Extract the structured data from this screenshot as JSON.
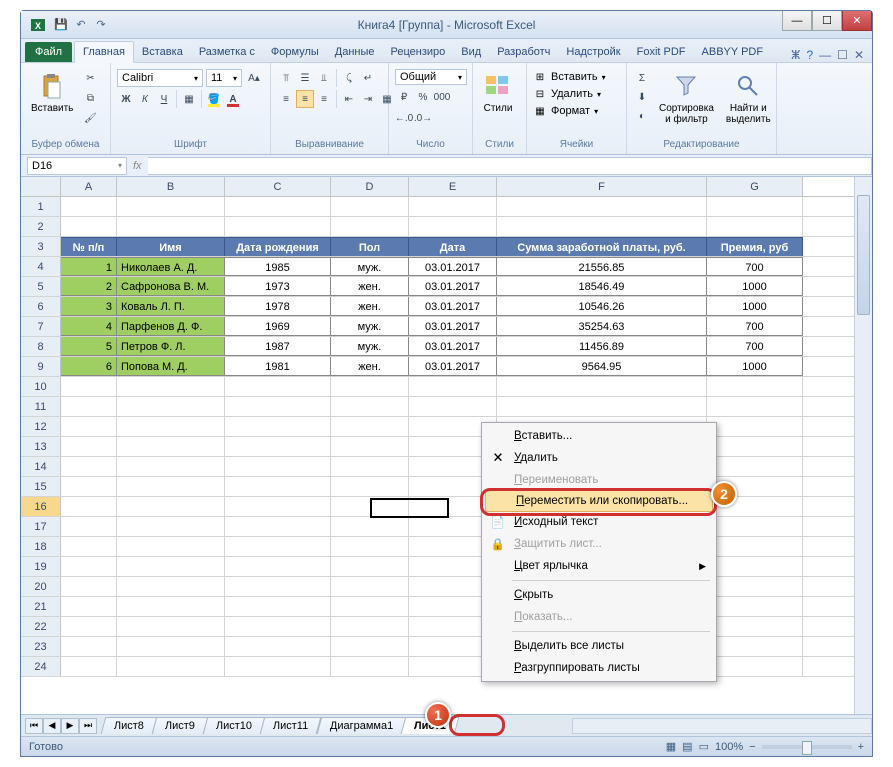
{
  "window": {
    "title": "Книга4  [Группа]  -  Microsoft Excel"
  },
  "ribbon_tabs": {
    "file": "Файл",
    "items": [
      "Главная",
      "Вставка",
      "Разметка с",
      "Формулы",
      "Данные",
      "Рецензиро",
      "Вид",
      "Разработч",
      "Надстройк",
      "Foxit PDF",
      "ABBYY PDF"
    ],
    "active_index": 0
  },
  "ribbon": {
    "clipboard": {
      "label": "Буфер обмена",
      "paste": "Вставить"
    },
    "font": {
      "label": "Шрифт",
      "name": "Calibri",
      "size": "11"
    },
    "alignment": {
      "label": "Выравнивание"
    },
    "number": {
      "label": "Число",
      "format": "Общий"
    },
    "styles": {
      "label": "Стили",
      "btn": "Стили"
    },
    "cells": {
      "label": "Ячейки",
      "insert": "Вставить",
      "delete": "Удалить",
      "format": "Формат"
    },
    "editing": {
      "label": "Редактирование",
      "sort": "Сортировка\nи фильтр",
      "find": "Найти и\nвыделить"
    }
  },
  "namebox": "D16",
  "fx_label": "fx",
  "columns": [
    "A",
    "B",
    "C",
    "D",
    "E",
    "F",
    "G"
  ],
  "table": {
    "headers": [
      "№ п/п",
      "Имя",
      "Дата рождения",
      "Пол",
      "Дата",
      "Сумма заработной платы, руб.",
      "Премия, руб"
    ],
    "rows": [
      [
        "1",
        "Николаев А. Д.",
        "1985",
        "муж.",
        "03.01.2017",
        "21556.85",
        "700"
      ],
      [
        "2",
        "Сафронова В. М.",
        "1973",
        "жен.",
        "03.01.2017",
        "18546.49",
        "1000"
      ],
      [
        "3",
        "Коваль Л. П.",
        "1978",
        "жен.",
        "03.01.2017",
        "10546.26",
        "1000"
      ],
      [
        "4",
        "Парфенов Д. Ф.",
        "1969",
        "муж.",
        "03.01.2017",
        "35254.63",
        "700"
      ],
      [
        "5",
        "Петров Ф. Л.",
        "1987",
        "муж.",
        "03.01.2017",
        "11456.89",
        "700"
      ],
      [
        "6",
        "Попова М. Д.",
        "1981",
        "жен.",
        "03.01.2017",
        "9564.95",
        "1000"
      ]
    ]
  },
  "context_menu": {
    "items": [
      {
        "label": "Вставить...",
        "icon": "",
        "enabled": true
      },
      {
        "label": "Удалить",
        "icon": "del",
        "enabled": true
      },
      {
        "label": "Переименовать",
        "icon": "",
        "enabled": false
      },
      {
        "label": "Переместить или скопировать...",
        "icon": "",
        "enabled": true,
        "highlight": true
      },
      {
        "label": "Исходный текст",
        "icon": "code",
        "enabled": true
      },
      {
        "label": "Защитить лист...",
        "icon": "lock",
        "enabled": false
      },
      {
        "label": "Цвет ярлычка",
        "icon": "",
        "enabled": true,
        "submenu": true
      },
      {
        "label": "Скрыть",
        "icon": "",
        "enabled": true
      },
      {
        "label": "Показать...",
        "icon": "",
        "enabled": false
      },
      {
        "label": "Выделить все листы",
        "icon": "",
        "enabled": true
      },
      {
        "label": "Разгруппировать листы",
        "icon": "",
        "enabled": true
      }
    ]
  },
  "sheet_tabs": [
    "Лист8",
    "Лист9",
    "Лист10",
    "Лист11",
    "Диаграмма1",
    "Лист1"
  ],
  "active_sheet_index": 5,
  "status": {
    "ready": "Готово",
    "zoom": "100%"
  },
  "badges": {
    "b1": "1",
    "b2": "2"
  }
}
